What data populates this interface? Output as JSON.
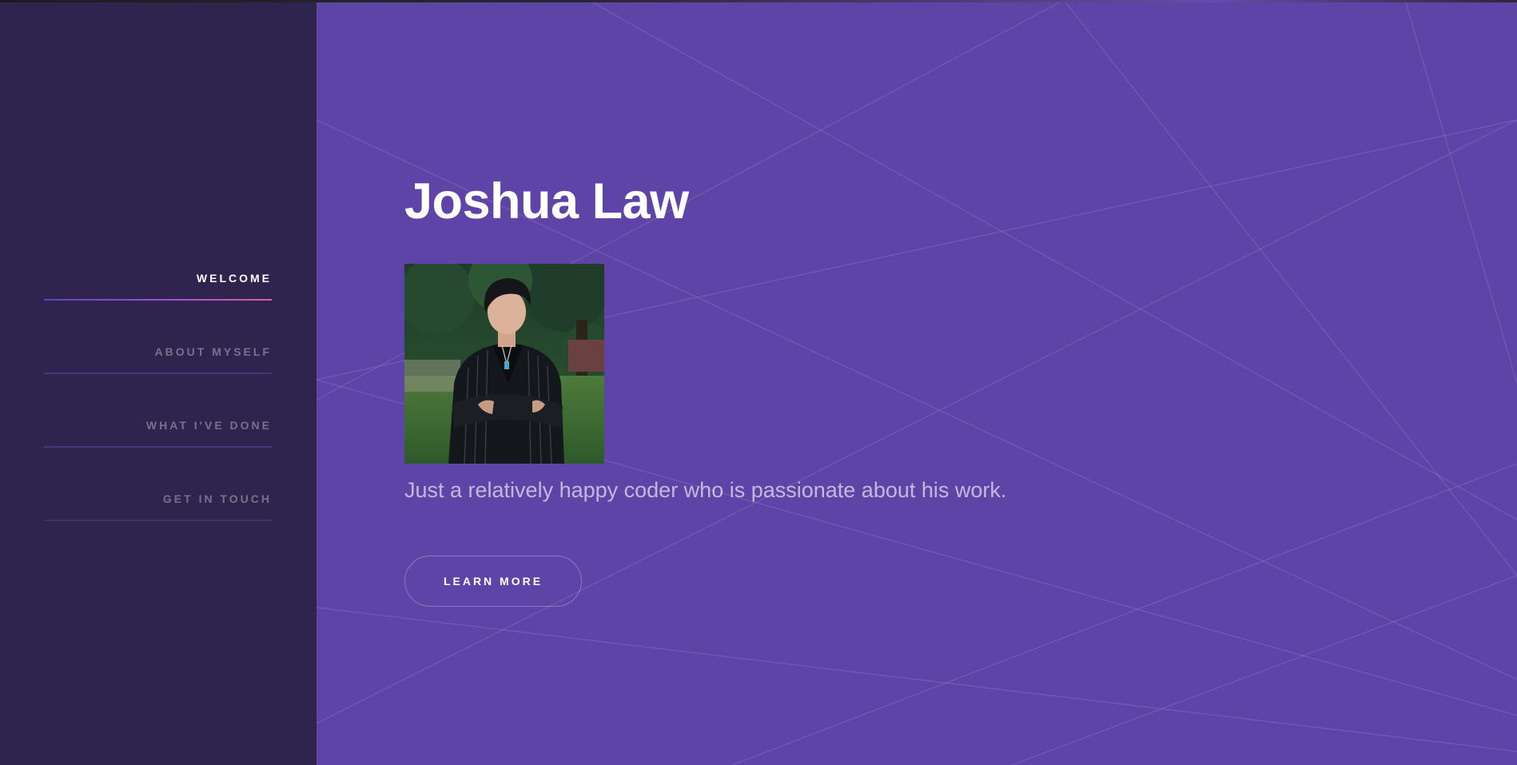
{
  "site": {
    "name": "Joshua Law",
    "tagline": "Just a relatively happy coder who is passionate about his work."
  },
  "sidebar": {
    "items": [
      {
        "label": "WELCOME",
        "active": true
      },
      {
        "label": "ABOUT MYSELF",
        "active": false
      },
      {
        "label": "WHAT I'VE DONE",
        "active": false
      },
      {
        "label": "GET IN TOUCH",
        "active": false
      }
    ]
  },
  "hero": {
    "cta_label": "LEARN MORE",
    "photo_icon": "portrait-photo"
  },
  "colors": {
    "sidebar_bg": "#2f244e",
    "main_bg": "#5e44a6",
    "accent_start": "#5e42c8",
    "accent_end": "#e05aa8",
    "text": "#ffffff"
  }
}
